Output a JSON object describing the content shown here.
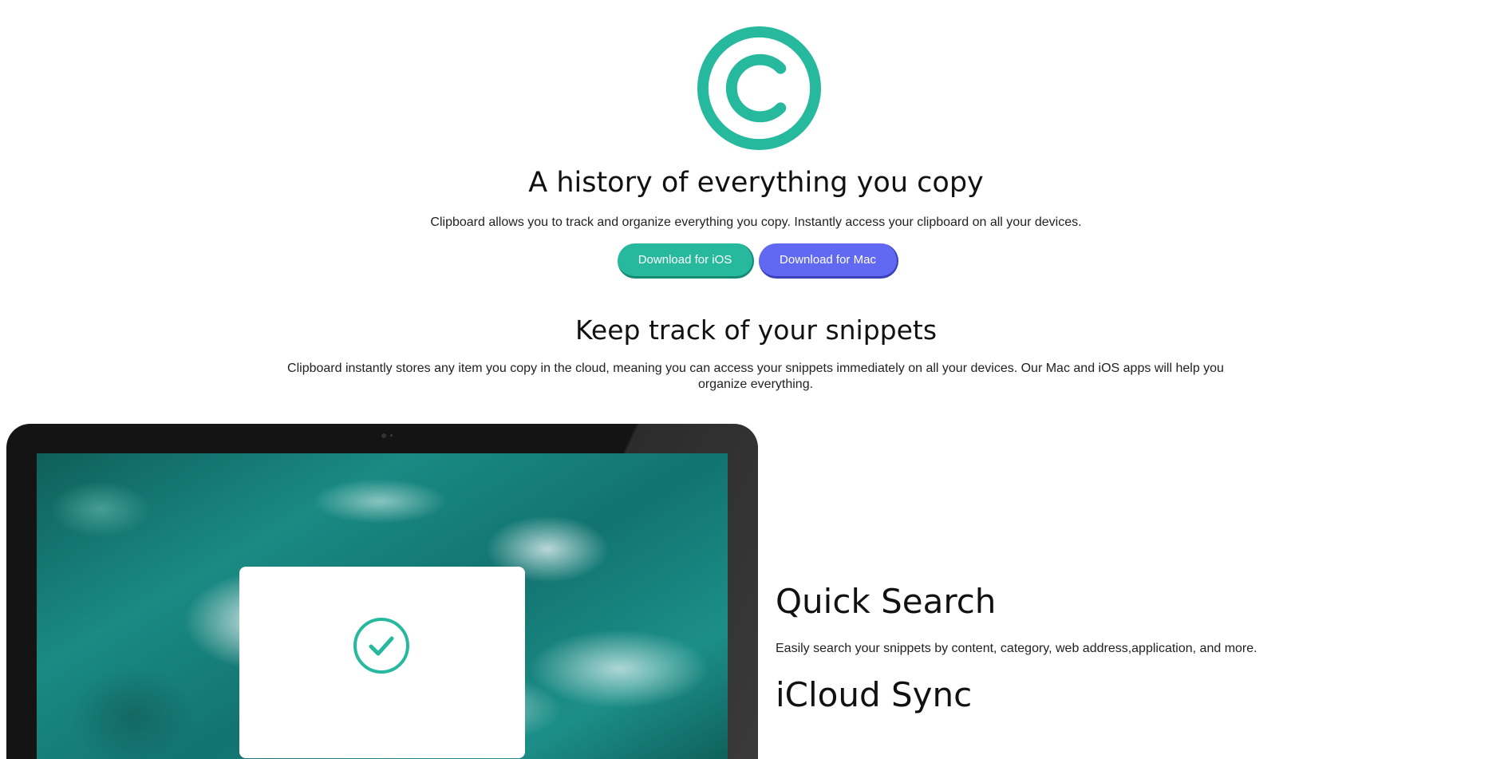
{
  "hero": {
    "title": "A history of everything you copy",
    "subtitle": "Clipboard allows you to track and organize everything you copy. Instantly access your clipboard on all your devices.",
    "buttons": {
      "ios_label": "Download for iOS",
      "mac_label": "Download for Mac"
    }
  },
  "snippets": {
    "title": "Keep track of your snippets",
    "description": "Clipboard instantly stores any item you copy in the cloud, meaning you can access your snippets immediately on all your devices. Our Mac and iOS apps will help you organize everything."
  },
  "features": [
    {
      "title": "Quick Search",
      "description": "Easily search your snippets by content, category, web address,application, and more."
    },
    {
      "title": "iCloud Sync"
    }
  ],
  "icons": {
    "logo": "copyright-logo-icon",
    "check": "check-circle-icon"
  },
  "colors": {
    "accent": "#27b99e",
    "ios_button": "#27b99e",
    "mac_button": "#6169f2",
    "device_frame": "#141414"
  }
}
